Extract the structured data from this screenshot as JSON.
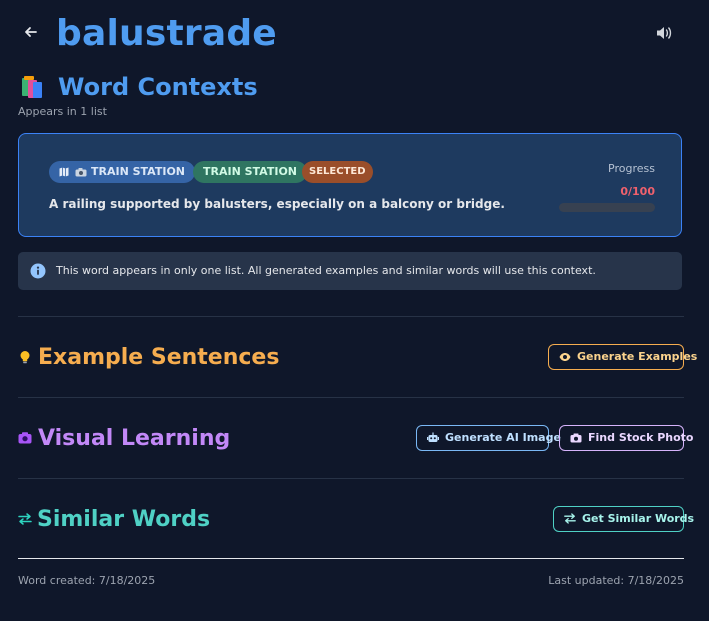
{
  "header": {
    "back_icon": "arrow-left-icon",
    "word": "balustrade",
    "speaker_icon": "speaker-icon"
  },
  "contexts": {
    "icon": "books-icon",
    "title": "Word Contexts",
    "appears": "Appears in 1 list",
    "card": {
      "list_badge": "TRAIN STATION",
      "list_badge_icons": [
        "map-icon",
        "camera-icon"
      ],
      "context_badge": "TRAIN STATION",
      "selected_badge": "SELECTED",
      "definition": "A railing supported by balusters, especially on a balcony or bridge.",
      "progress_label": "Progress",
      "progress_value": "0/100",
      "progress_fraction": 0
    },
    "info": "This word appears in only one list. All generated examples and similar words will use this context."
  },
  "sections": {
    "examples": {
      "title": "Example Sentences",
      "icon": "lightbulb-icon",
      "button": "Generate Examples",
      "button_icon": "eye-icon"
    },
    "visual": {
      "title": "Visual Learning",
      "icon": "camera-icon",
      "ai_button": "Generate AI Image",
      "ai_button_icon": "robot-icon",
      "stock_button": "Find Stock Photo",
      "stock_button_icon": "camera-icon"
    },
    "similar": {
      "title": "Similar Words",
      "icon": "swap-arrows-icon",
      "button": "Get Similar Words",
      "button_icon": "swap-arrows-icon"
    }
  },
  "footer": {
    "created": "Word created: 7/18/2025",
    "updated": "Last updated: 7/18/2025"
  },
  "colors": {
    "background": "#0f172a",
    "accent_blue": "#4f9cf0",
    "orange": "#f6ad4f",
    "purple": "#c288f7",
    "teal": "#4fd1c5",
    "progress_red": "#f0616d"
  }
}
